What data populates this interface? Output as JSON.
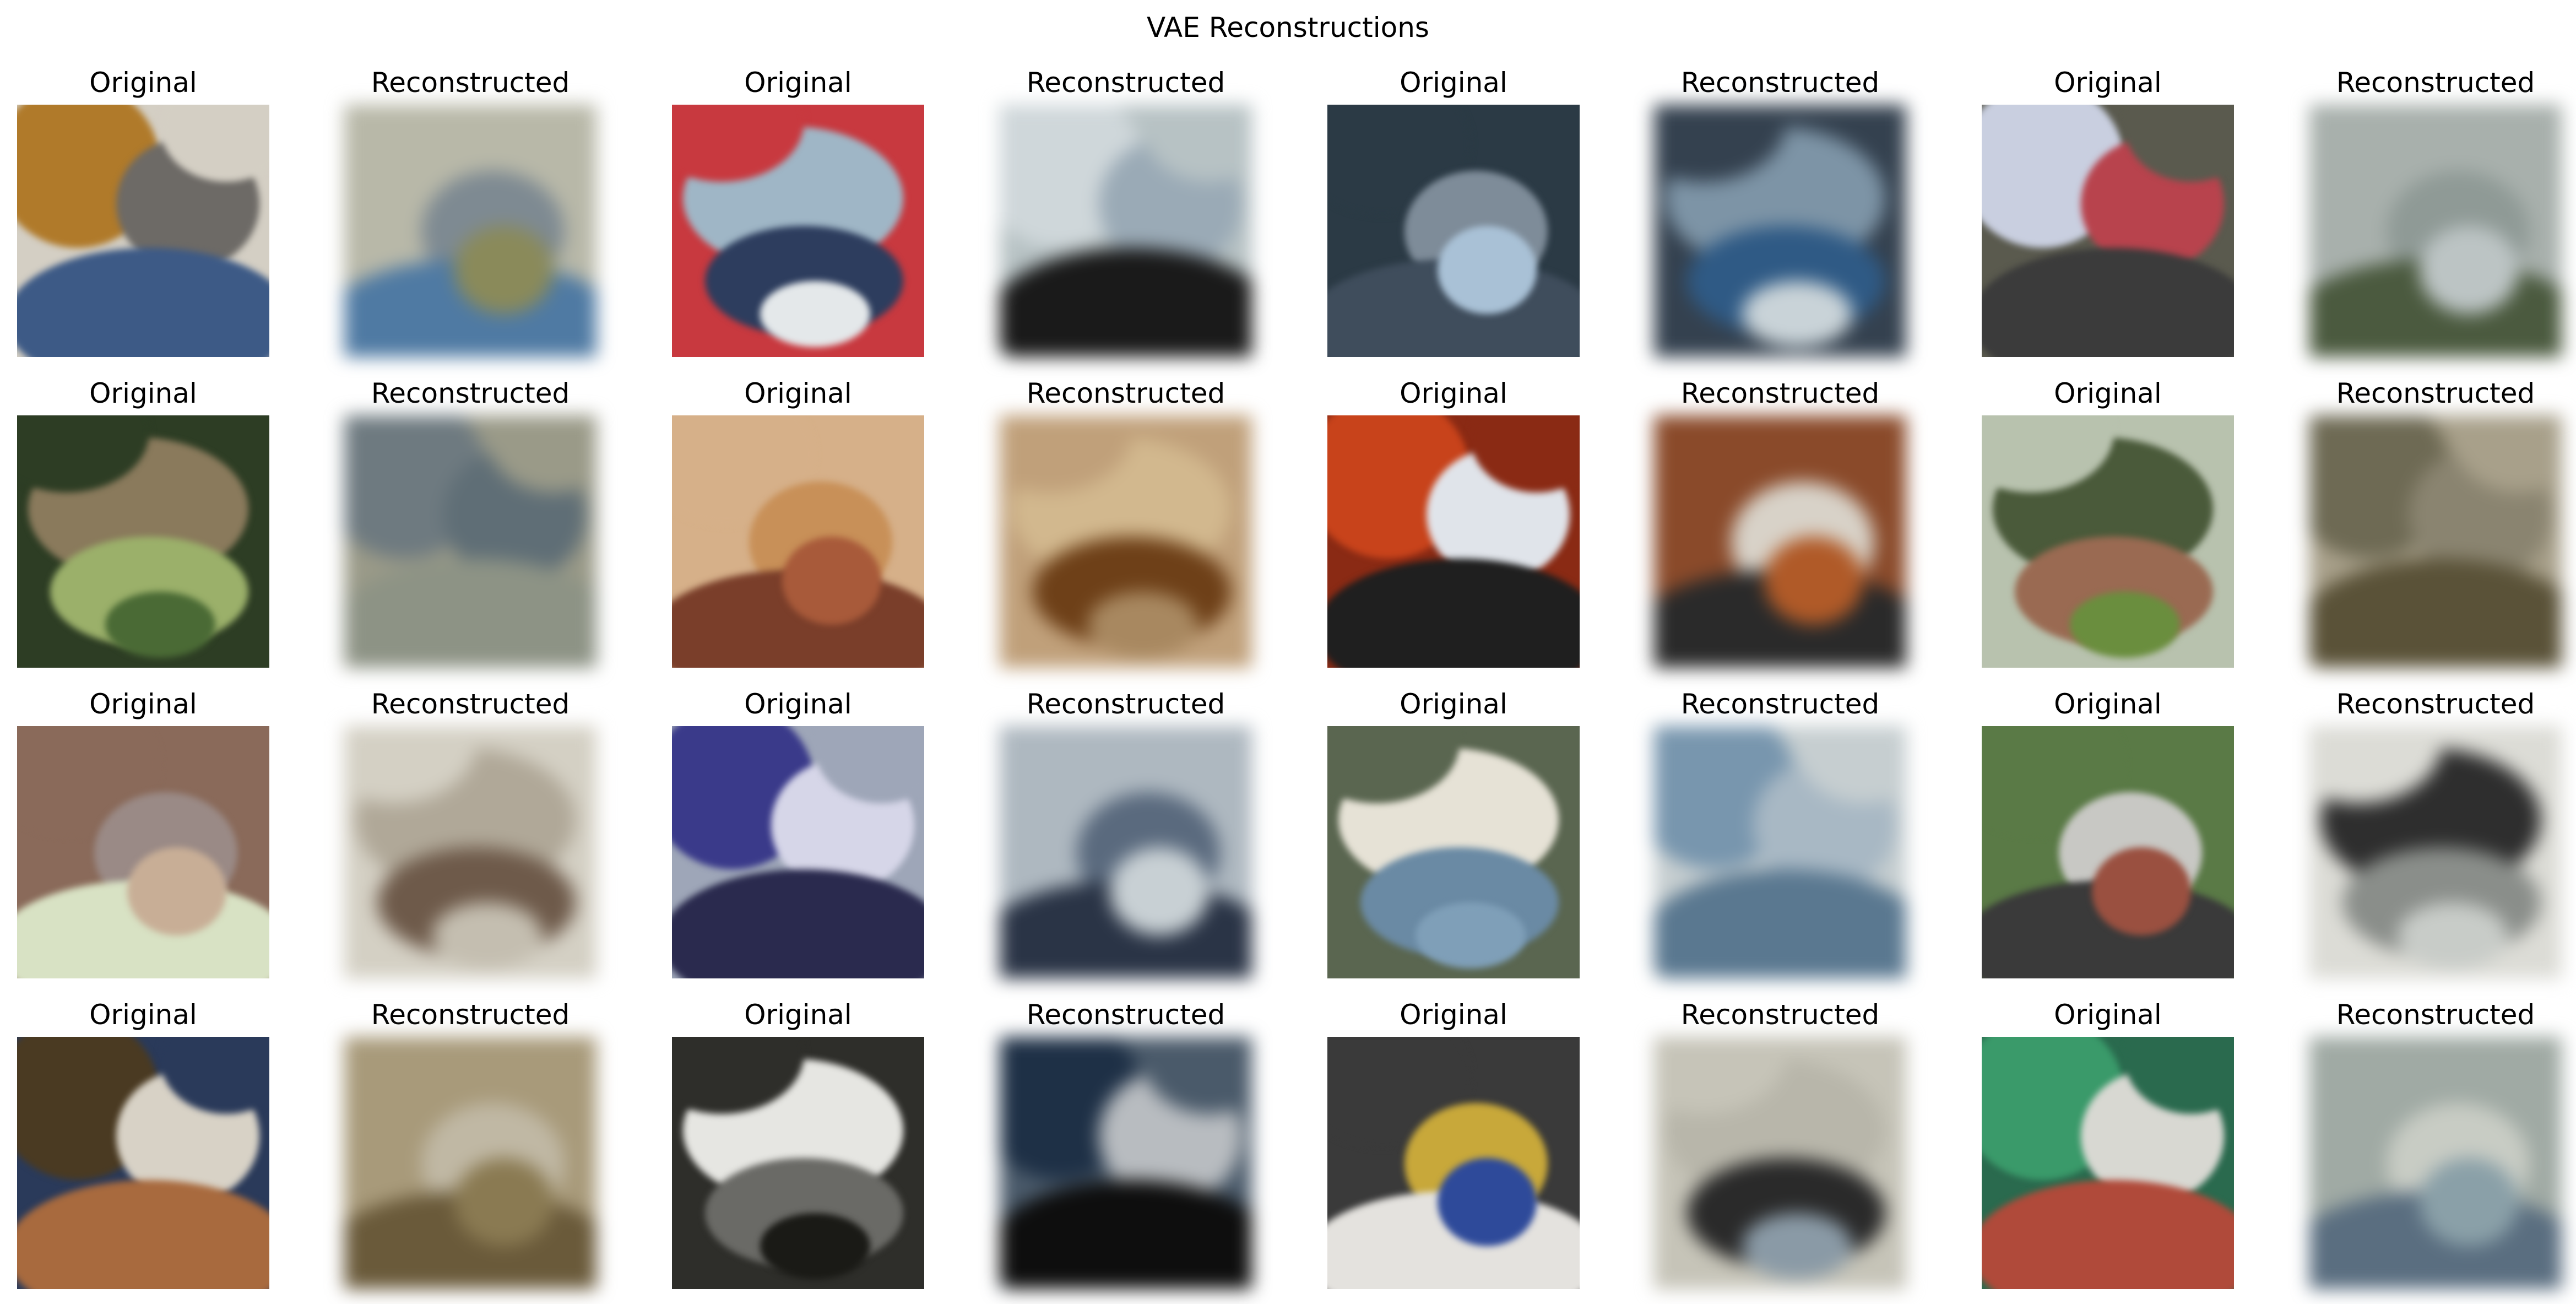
{
  "figure": {
    "title": "VAE Reconstructions"
  },
  "cells": [
    {
      "label": "Original",
      "kind": "original",
      "palette": [
        "#b07a2a",
        "#6d6a66",
        "#3d5a86",
        "#d4cfc4"
      ]
    },
    {
      "label": "Reconstructed",
      "kind": "reconstructed",
      "palette": [
        "#8a8a5a",
        "#7e8a92",
        "#4f7aa3",
        "#b8b8a8"
      ]
    },
    {
      "label": "Original",
      "kind": "original",
      "palette": [
        "#e4e8ea",
        "#9fb6c6",
        "#2d3d5e",
        "#c8393f"
      ]
    },
    {
      "label": "Reconstructed",
      "kind": "reconstructed",
      "palette": [
        "#cfd7da",
        "#9aaab6",
        "#1a1a1a",
        "#b7c2c4"
      ]
    },
    {
      "label": "Original",
      "kind": "original",
      "palette": [
        "#a9c1d6",
        "#7e8c99",
        "#3f4d5c",
        "#2b3a45"
      ]
    },
    {
      "label": "Reconstructed",
      "kind": "reconstructed",
      "palette": [
        "#c9d3d8",
        "#7d94a6",
        "#2f5a85",
        "#34414f"
      ]
    },
    {
      "label": "Original",
      "kind": "original",
      "palette": [
        "#c9cfe0",
        "#b8434d",
        "#3b3b3b",
        "#5a5a4e"
      ]
    },
    {
      "label": "Reconstructed",
      "kind": "reconstructed",
      "palette": [
        "#bcc4c4",
        "#8f9a96",
        "#4b5a3f",
        "#a8b0ac"
      ]
    },
    {
      "label": "Original",
      "kind": "original",
      "palette": [
        "#4a6a35",
        "#8a7a5c",
        "#9bb06a",
        "#2d3d24"
      ]
    },
    {
      "label": "Reconstructed",
      "kind": "reconstructed",
      "palette": [
        "#6e7a80",
        "#5f6e76",
        "#8d9385",
        "#9a9a88"
      ]
    },
    {
      "label": "Original",
      "kind": "original",
      "palette": [
        "#a85a3a",
        "#c89058",
        "#7a3e2a",
        "#d6b089"
      ]
    },
    {
      "label": "Reconstructed",
      "kind": "reconstructed",
      "palette": [
        "#a88860",
        "#d2b88e",
        "#6e4018",
        "#c0a07a"
      ]
    },
    {
      "label": "Original",
      "kind": "original",
      "palette": [
        "#c8431b",
        "#e0e4ea",
        "#1f1f1f",
        "#8a2a14"
      ]
    },
    {
      "label": "Reconstructed",
      "kind": "reconstructed",
      "palette": [
        "#b05a28",
        "#d8d2c8",
        "#2a2a2a",
        "#8a4a2a"
      ]
    },
    {
      "label": "Original",
      "kind": "original",
      "palette": [
        "#6a8e3e",
        "#4a5a3a",
        "#9a6a52",
        "#b8c2ae"
      ]
    },
    {
      "label": "Reconstructed",
      "kind": "reconstructed",
      "palette": [
        "#6e6a54",
        "#8a8470",
        "#5a5238",
        "#a8a08a"
      ]
    },
    {
      "label": "Original",
      "kind": "original",
      "palette": [
        "#c8ae96",
        "#9a8a86",
        "#d8e2c4",
        "#8a6a5a"
      ]
    },
    {
      "label": "Reconstructed",
      "kind": "reconstructed",
      "palette": [
        "#c4beb0",
        "#b0a898",
        "#6e5a4a",
        "#d4d0c4"
      ]
    },
    {
      "label": "Original",
      "kind": "original",
      "palette": [
        "#3a3a8a",
        "#d6d6e8",
        "#2a2a4e",
        "#9ea6b8"
      ]
    },
    {
      "label": "Reconstructed",
      "kind": "reconstructed",
      "palette": [
        "#c8d0d4",
        "#5a6a7e",
        "#2a3446",
        "#aeb8c0"
      ]
    },
    {
      "label": "Original",
      "kind": "original",
      "palette": [
        "#7f9fb8",
        "#e6e2d6",
        "#6a8aa4",
        "#5a6650"
      ]
    },
    {
      "label": "Reconstructed",
      "kind": "reconstructed",
      "palette": [
        "#7896ae",
        "#a8b8c4",
        "#5a7890",
        "#c6ced0"
      ]
    },
    {
      "label": "Original",
      "kind": "original",
      "palette": [
        "#9a5040",
        "#c8c8c4",
        "#3a3a3a",
        "#5a7a46"
      ]
    },
    {
      "label": "Reconstructed",
      "kind": "reconstructed",
      "palette": [
        "#c8ccc8",
        "#2e2e2e",
        "#8a8e8a",
        "#dcdcd6"
      ]
    },
    {
      "label": "Original",
      "kind": "original",
      "palette": [
        "#4a3a22",
        "#d8d2c6",
        "#a86a3e",
        "#2a3a5a"
      ]
    },
    {
      "label": "Reconstructed",
      "kind": "reconstructed",
      "palette": [
        "#8a7a52",
        "#c0b8a4",
        "#6a5a3a",
        "#a89a7a"
      ]
    },
    {
      "label": "Original",
      "kind": "original",
      "palette": [
        "#1a1a16",
        "#e6e6e2",
        "#6a6a66",
        "#2e2e2a"
      ]
    },
    {
      "label": "Reconstructed",
      "kind": "reconstructed",
      "palette": [
        "#1e3046",
        "#b8bcc0",
        "#0e0e0e",
        "#4a5a6a"
      ]
    },
    {
      "label": "Original",
      "kind": "original",
      "palette": [
        "#2e4a9a",
        "#c8a83a",
        "#e4e2de",
        "#3a3a3a"
      ]
    },
    {
      "label": "Reconstructed",
      "kind": "reconstructed",
      "palette": [
        "#8a9aa6",
        "#b8b6aa",
        "#2a2a2a",
        "#c6c4b8"
      ]
    },
    {
      "label": "Original",
      "kind": "original",
      "palette": [
        "#3a9a6a",
        "#d8d8d2",
        "#b04a3a",
        "#2a6a4e"
      ]
    },
    {
      "label": "Reconstructed",
      "kind": "reconstructed",
      "palette": [
        "#8aa0a8",
        "#c8ccc4",
        "#5a6e80",
        "#a0aaa4"
      ]
    }
  ]
}
